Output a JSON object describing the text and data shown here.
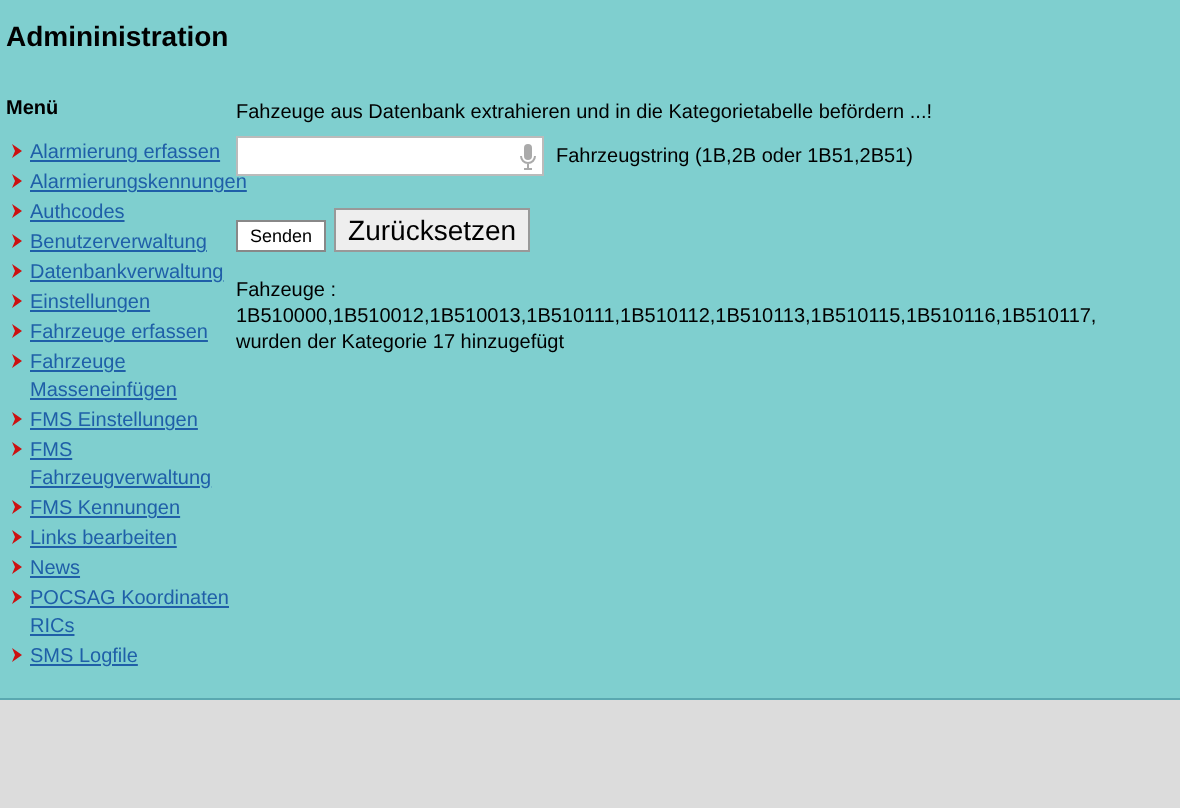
{
  "title": "Admininistration",
  "menu": {
    "heading": "Menü",
    "items": [
      "Alarmierung erfassen",
      "Alarmierungskennungen",
      "Authcodes",
      "Benutzerverwaltung",
      "Datenbankverwaltung",
      "Einstellungen",
      "Fahrzeuge erfassen",
      "Fahrzeuge Masseneinfügen",
      "FMS Einstellungen",
      "FMS Fahrzeugverwaltung",
      "FMS Kennungen",
      "Links bearbeiten",
      "News",
      "POCSAG Koordinaten RICs",
      "SMS Logfile"
    ]
  },
  "intro": "Fahzeuge aus Datenbank extrahieren und in die Kategorietabelle befördern ...!",
  "field": {
    "hint": "Fahrzeugstring (1B,2B oder 1B51,2B51)"
  },
  "buttons": [
    "Senden",
    "Zurücksetzen"
  ],
  "result": [
    "Fahzeuge :",
    "1B510000,1B510012,1B510013,1B510111,1B510112,1B510113,1B510115,1B510116,1B510117,",
    "wurden der Kategorie 17 hinzugefügt"
  ]
}
